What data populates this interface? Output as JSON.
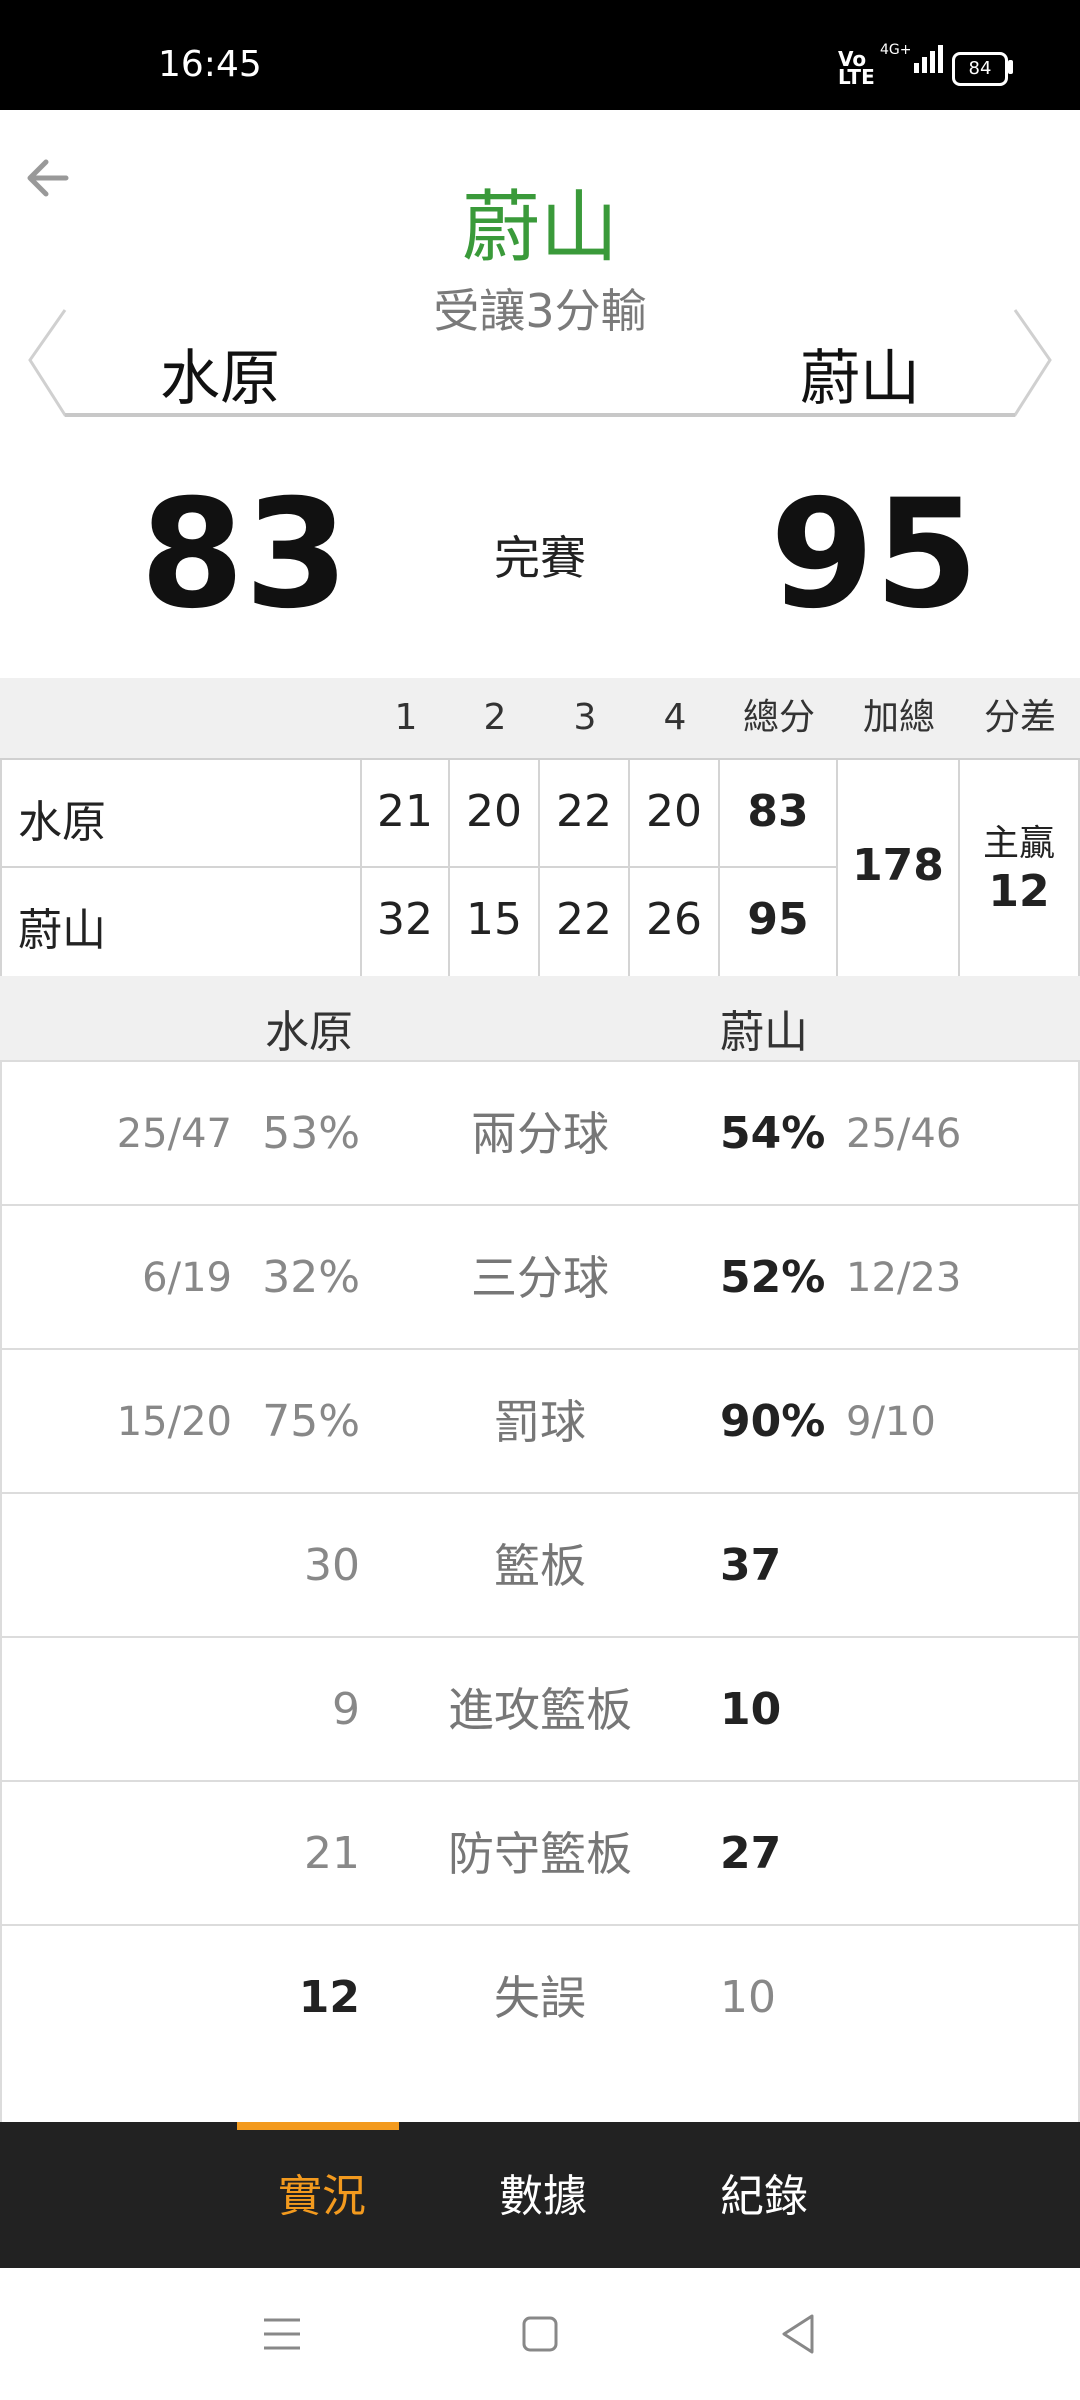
{
  "status_bar": {
    "time": "16:45",
    "volte": "Vo\nLTE",
    "network": "4G+",
    "battery": "84"
  },
  "header": {
    "result_team": "蔚山",
    "result_text": "受讓3分輸",
    "team_left": "水原",
    "team_right": "蔚山",
    "score_left": "83",
    "score_right": "95",
    "game_status": "完賽"
  },
  "quarter_table": {
    "headers": [
      "1",
      "2",
      "3",
      "4",
      "總分",
      "加總",
      "分差"
    ],
    "rows": [
      {
        "team": "水原",
        "q": [
          "21",
          "20",
          "22",
          "20"
        ],
        "total": "83"
      },
      {
        "team": "蔚山",
        "q": [
          "32",
          "15",
          "22",
          "26"
        ],
        "total": "95"
      }
    ],
    "combined": "178",
    "diff_label": "主贏",
    "diff_value": "12"
  },
  "stats": {
    "team_left": "水原",
    "team_right": "蔚山",
    "rows": [
      {
        "label": "兩分球",
        "left_frac": "25/47",
        "left": "53%",
        "right": "54%",
        "right_frac": "25/46",
        "winner": "right"
      },
      {
        "label": "三分球",
        "left_frac": "6/19",
        "left": "32%",
        "right": "52%",
        "right_frac": "12/23",
        "winner": "right"
      },
      {
        "label": "罰球",
        "left_frac": "15/20",
        "left": "75%",
        "right": "90%",
        "right_frac": "9/10",
        "winner": "right"
      },
      {
        "label": "籃板",
        "left_frac": "",
        "left": "30",
        "right": "37",
        "right_frac": "",
        "winner": "right"
      },
      {
        "label": "進攻籃板",
        "left_frac": "",
        "left": "9",
        "right": "10",
        "right_frac": "",
        "winner": "right"
      },
      {
        "label": "防守籃板",
        "left_frac": "",
        "left": "21",
        "right": "27",
        "right_frac": "",
        "winner": "right"
      },
      {
        "label": "失誤",
        "left_frac": "",
        "left": "12",
        "right": "10",
        "right_frac": "",
        "winner": "left"
      }
    ]
  },
  "tabs": {
    "live": "實況",
    "data": "數據",
    "record": "紀錄",
    "active": "live",
    "active_color": "#f39a1e"
  },
  "icons": {
    "back": "arrow-left-icon",
    "menu": "menu-icon",
    "home": "home-square-icon",
    "nav_back": "triangle-back-icon"
  }
}
